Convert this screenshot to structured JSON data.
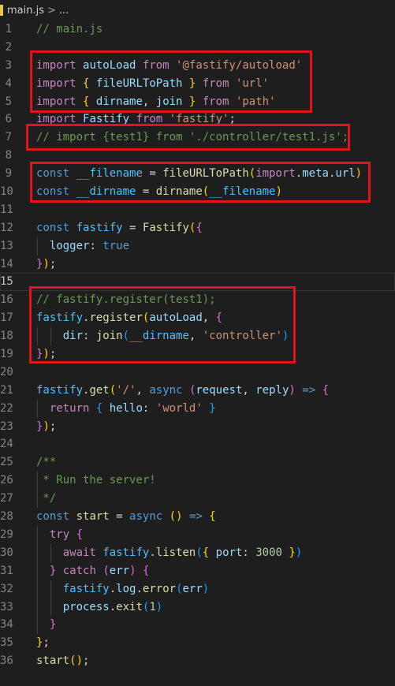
{
  "breadcrumb": {
    "file": "main.js",
    "chevron": ">",
    "more": "..."
  },
  "active_line": 15,
  "lines": [
    {
      "n": "1",
      "tokens": [
        [
          "cm",
          "// main.js"
        ]
      ]
    },
    {
      "n": "2",
      "tokens": []
    },
    {
      "n": "3",
      "tokens": [
        [
          "kw",
          "import"
        ],
        [
          "pl",
          " "
        ],
        [
          "vr",
          "autoLoad"
        ],
        [
          "pl",
          " "
        ],
        [
          "kw",
          "from"
        ],
        [
          "pl",
          " "
        ],
        [
          "str",
          "'@fastify/autoload'"
        ]
      ]
    },
    {
      "n": "4",
      "tokens": [
        [
          "kw",
          "import"
        ],
        [
          "pl",
          " "
        ],
        [
          "b1",
          "{"
        ],
        [
          "pl",
          " "
        ],
        [
          "vr",
          "fileURLToPath"
        ],
        [
          "pl",
          " "
        ],
        [
          "b1",
          "}"
        ],
        [
          "pl",
          " "
        ],
        [
          "kw",
          "from"
        ],
        [
          "pl",
          " "
        ],
        [
          "str",
          "'url'"
        ]
      ]
    },
    {
      "n": "5",
      "tokens": [
        [
          "kw",
          "import"
        ],
        [
          "pl",
          " "
        ],
        [
          "b1",
          "{"
        ],
        [
          "pl",
          " "
        ],
        [
          "vr",
          "dirname"
        ],
        [
          "pl",
          ", "
        ],
        [
          "vr",
          "join"
        ],
        [
          "pl",
          " "
        ],
        [
          "b1",
          "}"
        ],
        [
          "pl",
          " "
        ],
        [
          "kw",
          "from"
        ],
        [
          "pl",
          " "
        ],
        [
          "str",
          "'path'"
        ]
      ]
    },
    {
      "n": "6",
      "tokens": [
        [
          "kw",
          "import"
        ],
        [
          "pl",
          " "
        ],
        [
          "vr",
          "Fastify"
        ],
        [
          "pl",
          " "
        ],
        [
          "kw",
          "from"
        ],
        [
          "pl",
          " "
        ],
        [
          "str",
          "'fastify'"
        ],
        [
          "pl",
          ";"
        ]
      ]
    },
    {
      "n": "7",
      "tokens": [
        [
          "cm",
          "// import {test1} from './controller/test1.js';"
        ]
      ]
    },
    {
      "n": "8",
      "tokens": []
    },
    {
      "n": "9",
      "tokens": [
        [
          "st",
          "const"
        ],
        [
          "pl",
          " "
        ],
        [
          "cn",
          "__filename"
        ],
        [
          "pl",
          " = "
        ],
        [
          "fn",
          "fileURLToPath"
        ],
        [
          "b1",
          "("
        ],
        [
          "kw",
          "import"
        ],
        [
          "pl",
          "."
        ],
        [
          "vr",
          "meta"
        ],
        [
          "pl",
          "."
        ],
        [
          "vr",
          "url"
        ],
        [
          "b1",
          ")"
        ]
      ]
    },
    {
      "n": "10",
      "tokens": [
        [
          "st",
          "const"
        ],
        [
          "pl",
          " "
        ],
        [
          "cn",
          "__dirname"
        ],
        [
          "pl",
          " = "
        ],
        [
          "fn",
          "dirname"
        ],
        [
          "b1",
          "("
        ],
        [
          "cn",
          "__filename"
        ],
        [
          "b1",
          ")"
        ]
      ]
    },
    {
      "n": "11",
      "tokens": []
    },
    {
      "n": "12",
      "tokens": [
        [
          "st",
          "const"
        ],
        [
          "pl",
          " "
        ],
        [
          "cn",
          "fastify"
        ],
        [
          "pl",
          " = "
        ],
        [
          "fn",
          "Fastify"
        ],
        [
          "b1",
          "("
        ],
        [
          "b2",
          "{"
        ]
      ]
    },
    {
      "n": "13",
      "tokens": [
        [
          "pl",
          "  "
        ],
        [
          "vr",
          "logger"
        ],
        [
          "pl",
          ": "
        ],
        [
          "st",
          "true"
        ]
      ]
    },
    {
      "n": "14",
      "tokens": [
        [
          "b2",
          "}"
        ],
        [
          "b1",
          ")"
        ],
        [
          "pl",
          ";"
        ]
      ]
    },
    {
      "n": "15",
      "tokens": []
    },
    {
      "n": "16",
      "tokens": [
        [
          "cm",
          "// fastify.register(test1);"
        ]
      ]
    },
    {
      "n": "17",
      "tokens": [
        [
          "cn",
          "fastify"
        ],
        [
          "pl",
          "."
        ],
        [
          "fn",
          "register"
        ],
        [
          "b1",
          "("
        ],
        [
          "vr",
          "autoLoad"
        ],
        [
          "pl",
          ", "
        ],
        [
          "b2",
          "{"
        ]
      ]
    },
    {
      "n": "18",
      "tokens": [
        [
          "pl",
          "    "
        ],
        [
          "vr",
          "dir"
        ],
        [
          "pl",
          ": "
        ],
        [
          "fn",
          "join"
        ],
        [
          "b3",
          "("
        ],
        [
          "cn",
          "__dirname"
        ],
        [
          "pl",
          ", "
        ],
        [
          "str",
          "'controller'"
        ],
        [
          "b3",
          ")"
        ]
      ]
    },
    {
      "n": "19",
      "tokens": [
        [
          "b2",
          "}"
        ],
        [
          "b1",
          ")"
        ],
        [
          "pl",
          ";"
        ]
      ]
    },
    {
      "n": "20",
      "tokens": []
    },
    {
      "n": "21",
      "tokens": [
        [
          "cn",
          "fastify"
        ],
        [
          "pl",
          "."
        ],
        [
          "fn",
          "get"
        ],
        [
          "b1",
          "("
        ],
        [
          "str",
          "'/'"
        ],
        [
          "pl",
          ", "
        ],
        [
          "st",
          "async"
        ],
        [
          "pl",
          " "
        ],
        [
          "b2",
          "("
        ],
        [
          "vr",
          "request"
        ],
        [
          "pl",
          ", "
        ],
        [
          "vr",
          "reply"
        ],
        [
          "b2",
          ")"
        ],
        [
          "pl",
          " "
        ],
        [
          "st",
          "=>"
        ],
        [
          "pl",
          " "
        ],
        [
          "b2",
          "{"
        ]
      ]
    },
    {
      "n": "22",
      "tokens": [
        [
          "pl",
          "  "
        ],
        [
          "kw",
          "return"
        ],
        [
          "pl",
          " "
        ],
        [
          "b3",
          "{"
        ],
        [
          "pl",
          " "
        ],
        [
          "vr",
          "hello"
        ],
        [
          "pl",
          ": "
        ],
        [
          "str",
          "'world'"
        ],
        [
          "pl",
          " "
        ],
        [
          "b3",
          "}"
        ]
      ]
    },
    {
      "n": "23",
      "tokens": [
        [
          "b2",
          "}"
        ],
        [
          "b1",
          ")"
        ],
        [
          "pl",
          ";"
        ]
      ]
    },
    {
      "n": "24",
      "tokens": []
    },
    {
      "n": "25",
      "tokens": [
        [
          "cm",
          "/**"
        ]
      ]
    },
    {
      "n": "26",
      "tokens": [
        [
          "cm",
          " * Run the server!"
        ]
      ]
    },
    {
      "n": "27",
      "tokens": [
        [
          "cm",
          " */"
        ]
      ]
    },
    {
      "n": "28",
      "tokens": [
        [
          "st",
          "const"
        ],
        [
          "pl",
          " "
        ],
        [
          "fn",
          "start"
        ],
        [
          "pl",
          " = "
        ],
        [
          "st",
          "async"
        ],
        [
          "pl",
          " "
        ],
        [
          "b1",
          "("
        ],
        [
          "b1",
          ")"
        ],
        [
          "pl",
          " "
        ],
        [
          "st",
          "=>"
        ],
        [
          "pl",
          " "
        ],
        [
          "b1",
          "{"
        ]
      ]
    },
    {
      "n": "29",
      "tokens": [
        [
          "pl",
          "  "
        ],
        [
          "kw",
          "try"
        ],
        [
          "pl",
          " "
        ],
        [
          "b2",
          "{"
        ]
      ]
    },
    {
      "n": "30",
      "tokens": [
        [
          "pl",
          "    "
        ],
        [
          "kw",
          "await"
        ],
        [
          "pl",
          " "
        ],
        [
          "cn",
          "fastify"
        ],
        [
          "pl",
          "."
        ],
        [
          "fn",
          "listen"
        ],
        [
          "b3",
          "("
        ],
        [
          "b1",
          "{"
        ],
        [
          "pl",
          " "
        ],
        [
          "vr",
          "port"
        ],
        [
          "pl",
          ": "
        ],
        [
          "num",
          "3000"
        ],
        [
          "pl",
          " "
        ],
        [
          "b1",
          "}"
        ],
        [
          "b3",
          ")"
        ]
      ]
    },
    {
      "n": "31",
      "tokens": [
        [
          "pl",
          "  "
        ],
        [
          "b2",
          "}"
        ],
        [
          "pl",
          " "
        ],
        [
          "kw",
          "catch"
        ],
        [
          "pl",
          " "
        ],
        [
          "b2",
          "("
        ],
        [
          "vr",
          "err"
        ],
        [
          "b2",
          ")"
        ],
        [
          "pl",
          " "
        ],
        [
          "b2",
          "{"
        ]
      ]
    },
    {
      "n": "32",
      "tokens": [
        [
          "pl",
          "    "
        ],
        [
          "cn",
          "fastify"
        ],
        [
          "pl",
          "."
        ],
        [
          "vr",
          "log"
        ],
        [
          "pl",
          "."
        ],
        [
          "fn",
          "error"
        ],
        [
          "b3",
          "("
        ],
        [
          "vr",
          "err"
        ],
        [
          "b3",
          ")"
        ]
      ]
    },
    {
      "n": "33",
      "tokens": [
        [
          "pl",
          "    "
        ],
        [
          "vr",
          "process"
        ],
        [
          "pl",
          "."
        ],
        [
          "fn",
          "exit"
        ],
        [
          "b3",
          "("
        ],
        [
          "num",
          "1"
        ],
        [
          "b3",
          ")"
        ]
      ]
    },
    {
      "n": "34",
      "tokens": [
        [
          "pl",
          "  "
        ],
        [
          "b2",
          "}"
        ]
      ]
    },
    {
      "n": "35",
      "tokens": [
        [
          "b1",
          "}"
        ],
        [
          "pl",
          ";"
        ]
      ]
    },
    {
      "n": "36",
      "tokens": [
        [
          "fn",
          "start"
        ],
        [
          "b1",
          "("
        ],
        [
          "b1",
          ")"
        ],
        [
          "pl",
          ";"
        ]
      ]
    }
  ],
  "indent_guides": [
    {
      "line": "13",
      "col": 0
    },
    {
      "line": "18",
      "col": 0
    },
    {
      "line": "18",
      "col": 2
    },
    {
      "line": "22",
      "col": 0
    },
    {
      "line": "26",
      "col": 0
    },
    {
      "line": "27",
      "col": 0
    },
    {
      "line": "29",
      "col": 0
    },
    {
      "line": "30",
      "col": 0
    },
    {
      "line": "30",
      "col": 2
    },
    {
      "line": "31",
      "col": 0
    },
    {
      "line": "32",
      "col": 0
    },
    {
      "line": "32",
      "col": 2
    },
    {
      "line": "33",
      "col": 0
    },
    {
      "line": "33",
      "col": 2
    },
    {
      "line": "34",
      "col": 0
    }
  ],
  "annotation_color": "#e0141c"
}
